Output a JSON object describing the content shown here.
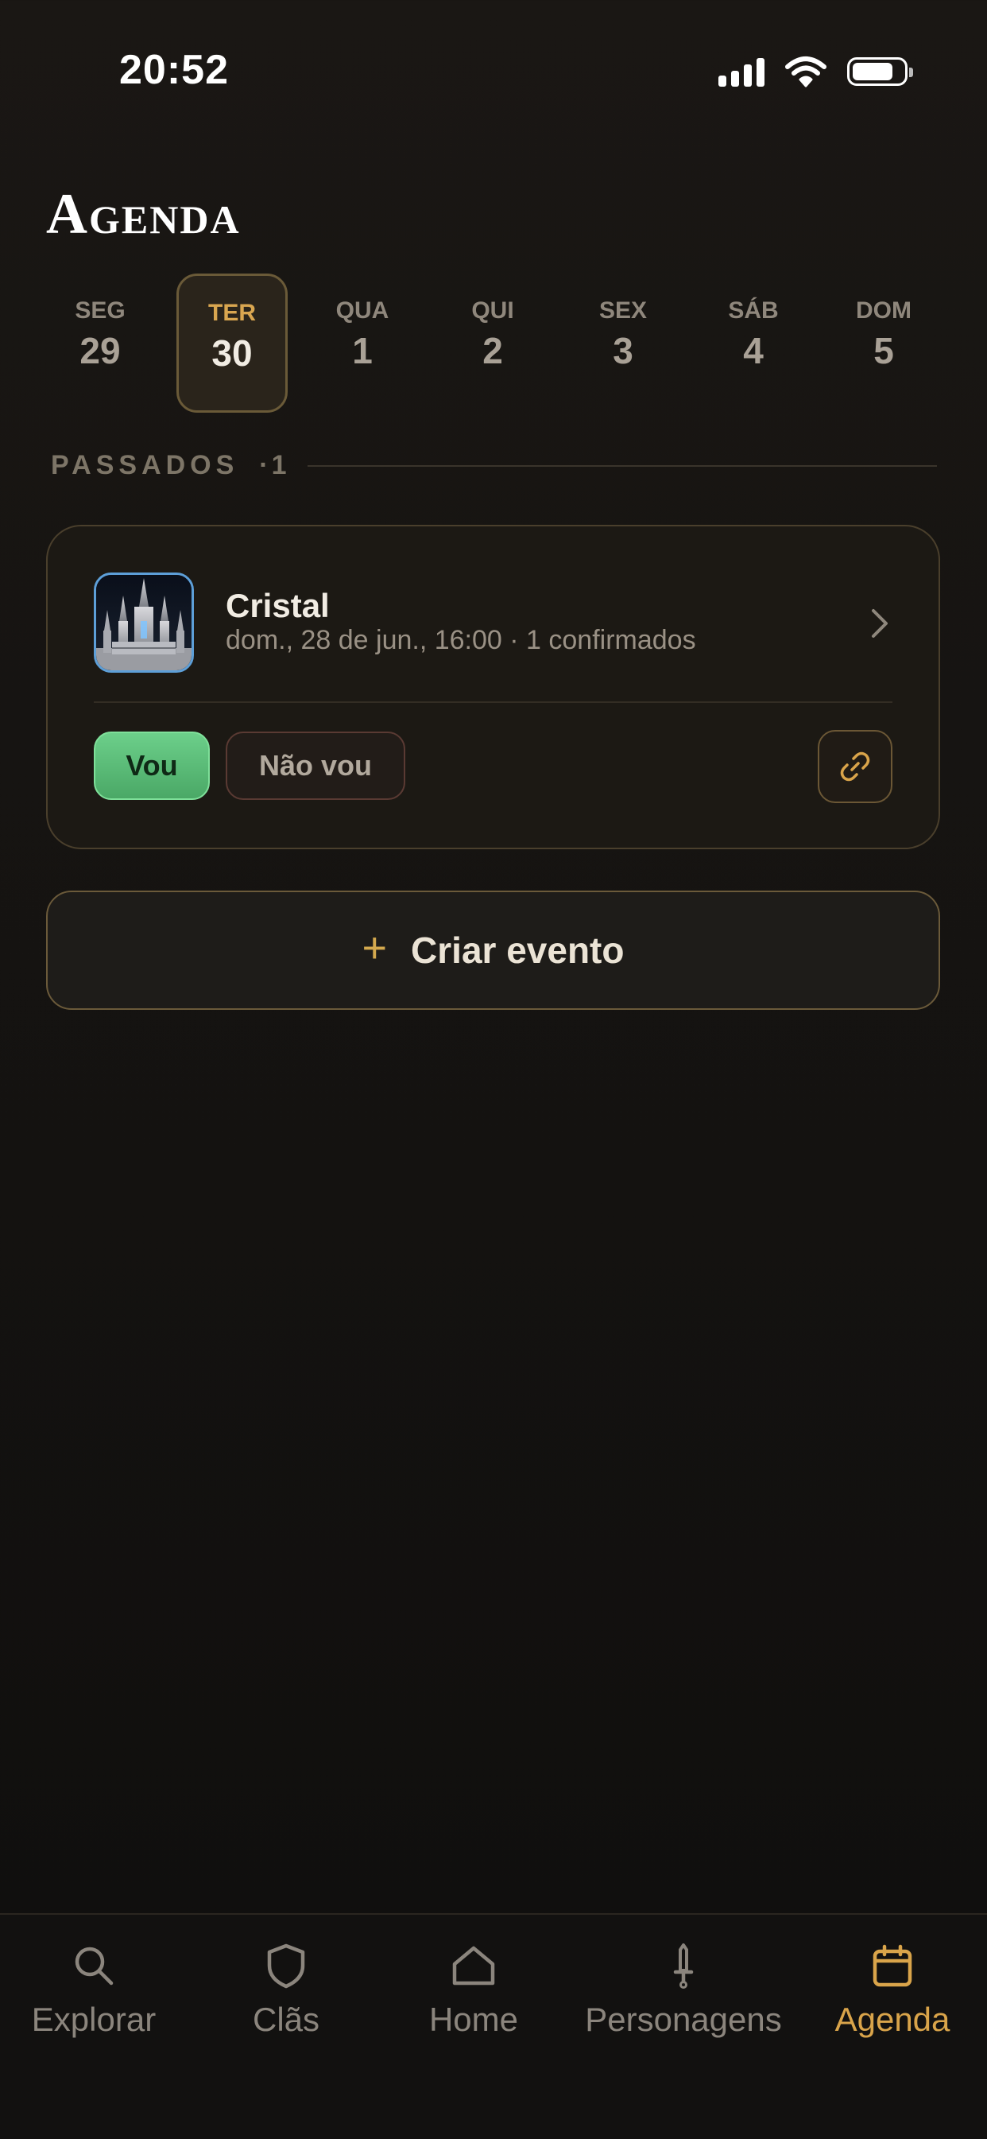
{
  "status_bar": {
    "time": "20:52"
  },
  "header": {
    "title": "Agenda"
  },
  "week": [
    {
      "name": "SEG",
      "num": "29",
      "selected": false
    },
    {
      "name": "TER",
      "num": "30",
      "selected": true
    },
    {
      "name": "QUA",
      "num": "1",
      "selected": false
    },
    {
      "name": "QUI",
      "num": "2",
      "selected": false
    },
    {
      "name": "SEX",
      "num": "3",
      "selected": false
    },
    {
      "name": "SÁB",
      "num": "4",
      "selected": false
    },
    {
      "name": "DOM",
      "num": "5",
      "selected": false
    }
  ],
  "past_section": {
    "label": "PASSADOS",
    "count": "·1"
  },
  "event": {
    "title": "Cristal",
    "meta": "dom., 28 de jun., 16:00 · 1 confirmados",
    "going_label": "Vou",
    "not_going_label": "Não vou",
    "thumbnail_icon": "castle-thumbnail"
  },
  "create_event": {
    "icon": "plus-icon",
    "label": "Criar evento"
  },
  "tabs": [
    {
      "label": "Explorar",
      "icon": "search-icon",
      "active": false
    },
    {
      "label": "Clãs",
      "icon": "shield-icon",
      "active": false
    },
    {
      "label": "Home",
      "icon": "home-icon",
      "active": false
    },
    {
      "label": "Personagens",
      "icon": "sword-icon",
      "active": false
    },
    {
      "label": "Agenda",
      "icon": "calendar-icon",
      "active": true
    }
  ],
  "colors": {
    "accent_gold": "#d9a44a",
    "going_green": "#5cbd78",
    "background": "#151311"
  }
}
